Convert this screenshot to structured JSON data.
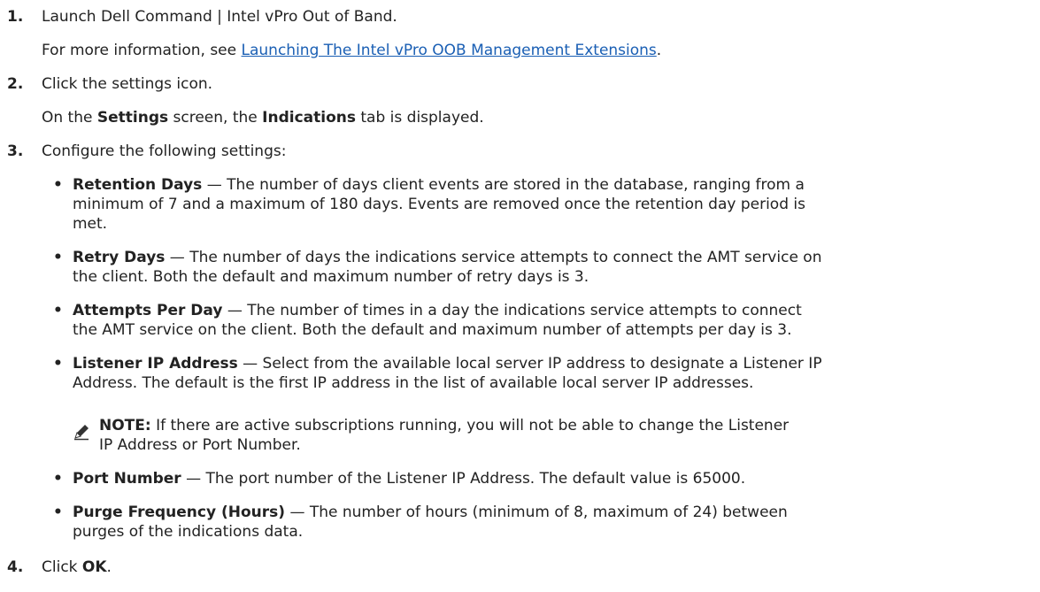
{
  "steps": [
    {
      "num": "1.",
      "main": "Launch Dell Command | Intel vPro Out of Band.",
      "sub_prefix": "For more information, see ",
      "sub_link": "Launching The Intel vPro OOB Management Extensions",
      "sub_suffix": "."
    },
    {
      "num": "2.",
      "main": "Click the settings icon.",
      "sub_p1": "On the ",
      "sub_b1": "Settings",
      "sub_p2": " screen, the ",
      "sub_b2": "Indications",
      "sub_p3": " tab is displayed."
    },
    {
      "num": "3.",
      "main": "Configure the following settings:"
    },
    {
      "num": "4.",
      "main_prefix": "Click ",
      "main_bold": "OK",
      "main_suffix": "."
    }
  ],
  "bullet_char": "•",
  "settings": [
    {
      "term": "Retention Days",
      "lines": [
        " — The number of days client events are stored in the database, ranging from a",
        "minimum of 7 and a maximum of 180 days. Events are removed once the retention day period is",
        "met."
      ]
    },
    {
      "term": "Retry Days",
      "lines": [
        " — The number of days the indications service attempts to connect the AMT service on",
        "the client. Both the default and maximum number of retry days is 3."
      ]
    },
    {
      "term": "Attempts Per Day",
      "lines": [
        " — The number of times in a day the indications service attempts to connect",
        "the AMT service on the client. Both the default and maximum number of attempts per day is 3."
      ]
    },
    {
      "term": "Listener IP Address",
      "lines": [
        " — Select from the available local server IP address to designate a Listener IP",
        "Address. The default is the first IP address in the list of available local server IP addresses."
      ]
    },
    {
      "term": "Port Number",
      "lines": [
        " — The port number of the Listener IP Address. The default value is 65000."
      ]
    },
    {
      "term": "Purge Frequency (Hours)",
      "lines": [
        " — The number of hours (minimum of 8, maximum of 24) between",
        "purges of the indications data."
      ]
    }
  ],
  "note": {
    "label": "NOTE:",
    "line1": " If there are active subscriptions running, you will not be able to change the Listener",
    "line2": "IP Address or Port Number.",
    "icon": "pencil-note-icon"
  }
}
